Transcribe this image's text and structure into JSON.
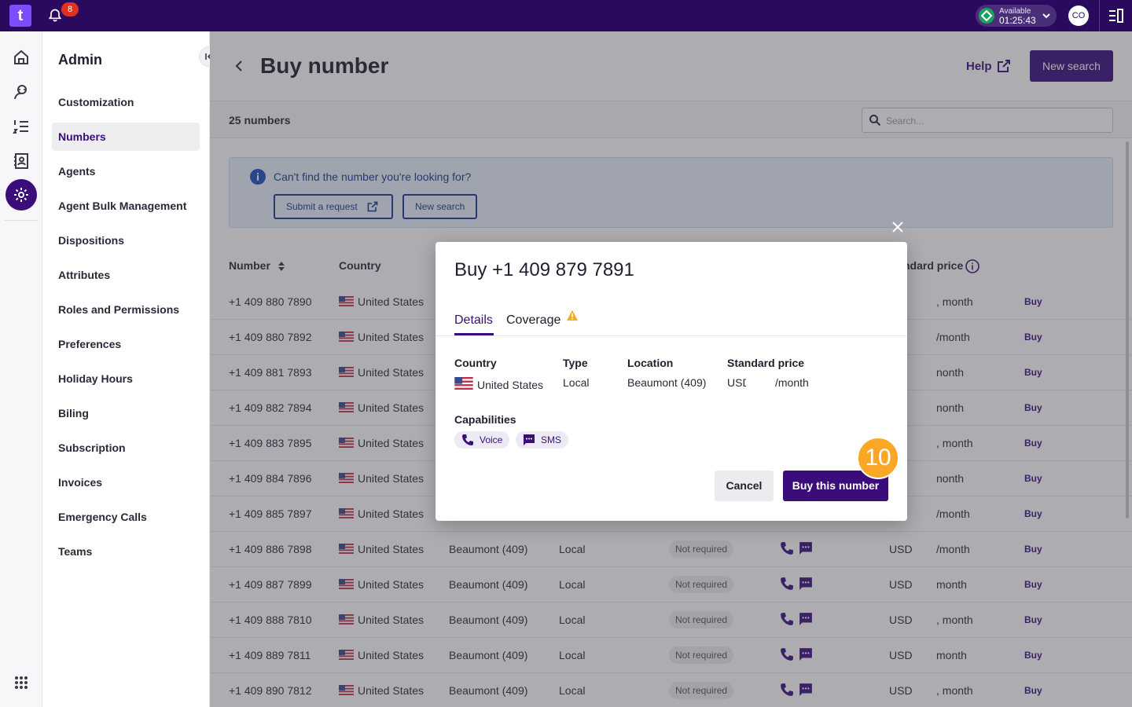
{
  "topbar": {
    "logo_text": "t",
    "notification_count": "8",
    "status_label": "Available",
    "status_time": "01:25:43",
    "user_initials": "CO"
  },
  "sidebar": {
    "title": "Admin",
    "items": [
      {
        "label": "Customization",
        "active": false
      },
      {
        "label": "Numbers",
        "active": true
      },
      {
        "label": "Agents",
        "active": false
      },
      {
        "label": "Agent Bulk Management",
        "active": false
      },
      {
        "label": "Dispositions",
        "active": false
      },
      {
        "label": "Attributes",
        "active": false
      },
      {
        "label": "Roles and Permissions",
        "active": false
      },
      {
        "label": "Preferences",
        "active": false
      },
      {
        "label": "Holiday Hours",
        "active": false
      },
      {
        "label": "Biling",
        "active": false
      },
      {
        "label": "Subscription",
        "active": false
      },
      {
        "label": "Invoices",
        "active": false
      },
      {
        "label": "Emergency Calls",
        "active": false
      },
      {
        "label": "Teams",
        "active": false
      }
    ]
  },
  "header": {
    "title": "Buy number",
    "help_label": "Help",
    "new_search_label": "New search"
  },
  "toolbar": {
    "count_text": "25 numbers",
    "search_placeholder": "Search..."
  },
  "banner": {
    "text": "Can't find the number you're looking for?",
    "submit_label": "Submit a request",
    "new_search_label": "New search"
  },
  "table": {
    "columns": {
      "number": "Number",
      "country": "Country",
      "price": "ndard price"
    },
    "rows": [
      {
        "number": "+1 409 880 7890",
        "country": "United States",
        "location": "",
        "type": "",
        "address": "",
        "currency": "",
        "price": ", month",
        "buy": "Buy"
      },
      {
        "number": "+1 409 880 7892",
        "country": "United States",
        "location": "",
        "type": "",
        "address": "",
        "currency": "",
        "price": "/month",
        "buy": "Buy"
      },
      {
        "number": "+1 409 881 7893",
        "country": "United States",
        "location": "",
        "type": "",
        "address": "",
        "currency": "",
        "price": "nonth",
        "buy": "Buy"
      },
      {
        "number": "+1 409 882 7894",
        "country": "United States",
        "location": "",
        "type": "",
        "address": "",
        "currency": "",
        "price": "nonth",
        "buy": "Buy"
      },
      {
        "number": "+1 409 883 7895",
        "country": "United States",
        "location": "",
        "type": "",
        "address": "",
        "currency": "",
        "price": ", month",
        "buy": "Buy"
      },
      {
        "number": "+1 409 884 7896",
        "country": "United States",
        "location": "",
        "type": "",
        "address": "",
        "currency": "",
        "price": "nonth",
        "buy": "Buy"
      },
      {
        "number": "+1 409 885 7897",
        "country": "United States",
        "location": "",
        "type": "",
        "address": "",
        "currency": "",
        "price": "/month",
        "buy": "Buy"
      },
      {
        "number": "+1 409 886 7898",
        "country": "United States",
        "location": "Beaumont (409)",
        "type": "Local",
        "address": "Not required",
        "currency": "USD",
        "price": "/month",
        "buy": "Buy"
      },
      {
        "number": "+1 409 887 7899",
        "country": "United States",
        "location": "Beaumont (409)",
        "type": "Local",
        "address": "Not required",
        "currency": "USD",
        "price": "month",
        "buy": "Buy"
      },
      {
        "number": "+1 409 888 7810",
        "country": "United States",
        "location": "Beaumont (409)",
        "type": "Local",
        "address": "Not required",
        "currency": "USD",
        "price": ", month",
        "buy": "Buy"
      },
      {
        "number": "+1 409 889 7811",
        "country": "United States",
        "location": "Beaumont (409)",
        "type": "Local",
        "address": "Not required",
        "currency": "USD",
        "price": "month",
        "buy": "Buy"
      },
      {
        "number": "+1 409 890 7812",
        "country": "United States",
        "location": "Beaumont (409)",
        "type": "Local",
        "address": "Not required",
        "currency": "USD",
        "price": ", month",
        "buy": "Buy"
      }
    ]
  },
  "modal": {
    "title": "Buy +1 409 879 7891",
    "tabs": {
      "details": "Details",
      "coverage": "Coverage"
    },
    "details": {
      "country_label": "Country",
      "country_value": "United States",
      "type_label": "Type",
      "type_value": "Local",
      "location_label": "Location",
      "location_value": "Beaumont (409)",
      "price_label": "Standard price",
      "price_currency": "USD",
      "price_unit": "/month"
    },
    "capabilities_label": "Capabilities",
    "capabilities": {
      "voice": "Voice",
      "sms": "SMS"
    },
    "cancel_label": "Cancel",
    "buy_label": "Buy this number"
  },
  "step_badge": "10",
  "colors": {
    "brand": "#2a0a5e",
    "accent": "#3a0d7a",
    "step": "#f9a825"
  }
}
